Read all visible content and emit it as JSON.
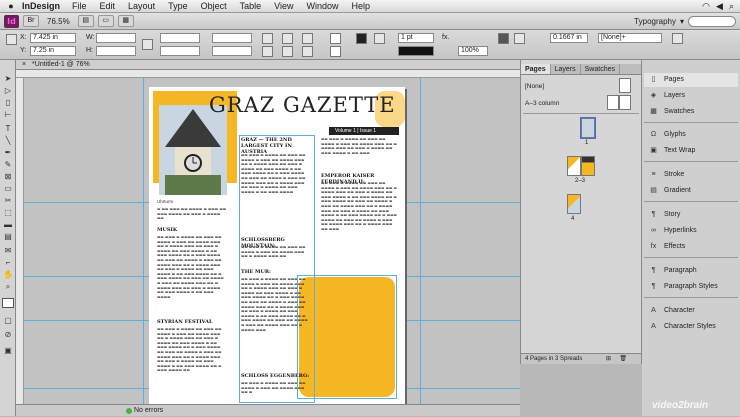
{
  "menubar": {
    "app_name": "InDesign",
    "items": [
      "File",
      "Edit",
      "Layout",
      "Type",
      "Object",
      "Table",
      "View",
      "Window",
      "Help"
    ]
  },
  "appbar": {
    "logo": "Id",
    "zoom": "76.5%",
    "workspace": "Typography"
  },
  "control": {
    "x_label": "X:",
    "x_value": "7.425 in",
    "y_label": "Y:",
    "y_value": "7.25 in",
    "w_label": "W:",
    "h_label": "H:",
    "stroke_weight": "1 pt",
    "opacity": "100%",
    "offset": "0.1667 in",
    "style": "[None]+"
  },
  "document": {
    "tab_title": "*Untitled-1 @ 76%"
  },
  "page": {
    "masthead": "GRAZ GAZETTE",
    "volume_bar": "Volume 1  |  Issue 1",
    "headline": "GRAZ — THE 2ND LARGEST CITY IN AUSTRIA",
    "subhead_1": "SCHLOSSBERG MOUNTAIN:",
    "subhead_2": "THE MUR:",
    "subhead_3": "SCHLOSS EGGENBERG:",
    "subhead_4": "EMPEROR KAISER FERDINAND II:",
    "subhead_5": "MUSIK",
    "subhead_6": "STYRIAN FESTIVAL",
    "caption": "Uhrturm"
  },
  "pages_panel": {
    "tabs": [
      "Pages",
      "Layers",
      "Swatches"
    ],
    "master_none": "[None]",
    "master_a": "A–3 column",
    "spread_label_1": "1",
    "spread_label_2": "2–3",
    "spread_label_3": "4",
    "footer": "4 Pages in 3 Spreads"
  },
  "dock": {
    "items": [
      "Pages",
      "Layers",
      "Swatches",
      "Glyphs",
      "Text Wrap",
      "Stroke",
      "Gradient",
      "Story",
      "Hyperlinks",
      "Effects",
      "Paragraph",
      "Paragraph Styles",
      "Character",
      "Character Styles"
    ]
  },
  "status": {
    "errors": "No errors"
  },
  "watermark": "video2brain"
}
